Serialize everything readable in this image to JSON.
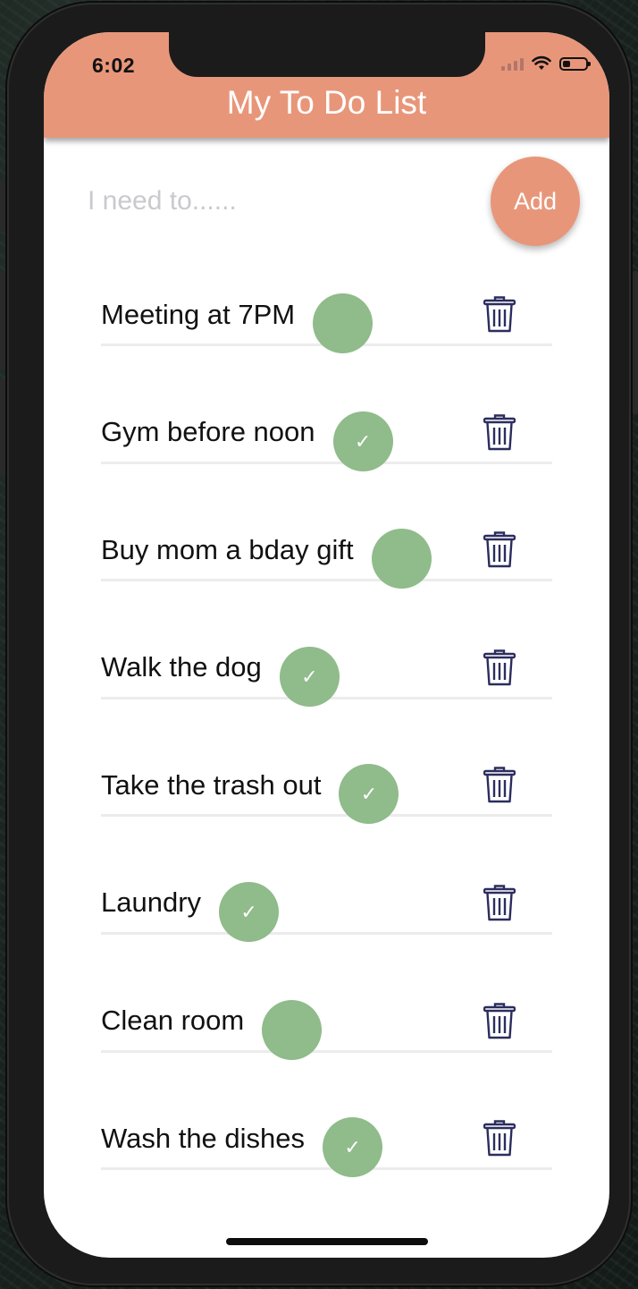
{
  "status_bar": {
    "time": "6:02",
    "icons": [
      "cellular-signal-icon",
      "wifi-icon",
      "battery-icon"
    ]
  },
  "header": {
    "title": "My To Do List"
  },
  "new_todo": {
    "placeholder": "I need to......",
    "value": "",
    "add_label": "Add"
  },
  "todos": [
    {
      "text": "Meeting at 7PM",
      "completed": false
    },
    {
      "text": "Gym before noon",
      "completed": true
    },
    {
      "text": "Buy mom a bday gift",
      "completed": false
    },
    {
      "text": "Walk the dog",
      "completed": true
    },
    {
      "text": "Take the trash out",
      "completed": true
    },
    {
      "text": "Laundry",
      "completed": true
    },
    {
      "text": "Clean room",
      "completed": false
    },
    {
      "text": "Wash the dishes",
      "completed": true
    }
  ],
  "icons": {
    "check": "checkmark-icon",
    "delete": "trash-icon"
  },
  "colors": {
    "accent": "#e8967a",
    "check_green": "#90bb8b",
    "trash_navy": "#2b2d5e",
    "divider": "#ececec",
    "placeholder": "#c9c9cf"
  }
}
